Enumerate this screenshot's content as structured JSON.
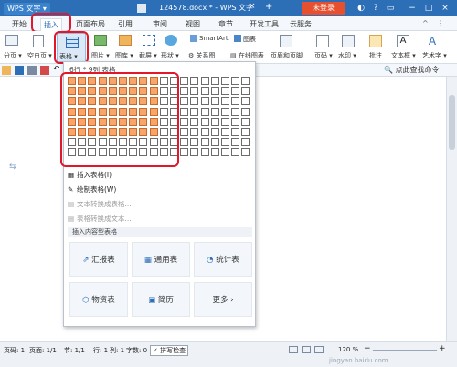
{
  "titlebar": {
    "app_name": "WPS 文字",
    "doc_title": "124578.docx * - WPS 文字",
    "login": "未登录"
  },
  "tabs": [
    "开始",
    "插入",
    "页面布局",
    "引用",
    "审阅",
    "视图",
    "章节",
    "开发工具",
    "云服务"
  ],
  "ribbon": {
    "page_break": "分页",
    "blank_page": "空白页",
    "table": "表格",
    "picture": "图片",
    "gallery": "图库",
    "screenshot": "截屏",
    "shape": "形状",
    "relation": "关系图",
    "smartart": "SmartArt",
    "chart": "图表",
    "online_chart": "在线图表",
    "header_footer": "页眉和页脚",
    "page_num": "页码",
    "watermark": "水印",
    "comment": "批注",
    "textbox": "文本框",
    "wordart": "艺术字"
  },
  "search": {
    "placeholder": "点此查找命令"
  },
  "dropdown": {
    "grid_label": "6行 * 9列 表格",
    "items": [
      "插入表格(I)",
      "绘制表格(W)",
      "文本转换成表格...",
      "表格转换成文本..."
    ],
    "section": "插入内容型表格",
    "templates": [
      "汇报表",
      "通用表",
      "统计表",
      "物资表",
      "简历",
      "更多"
    ]
  },
  "status": {
    "page": "页码: 1",
    "pages": "页面: 1/1",
    "section": "节: 1/1",
    "line": "行: 1",
    "col": "列: 1",
    "words": "字数: 0",
    "spell": "拼写检查",
    "zoom": "120 %",
    "watermark": "jingyan.baidu.com"
  }
}
